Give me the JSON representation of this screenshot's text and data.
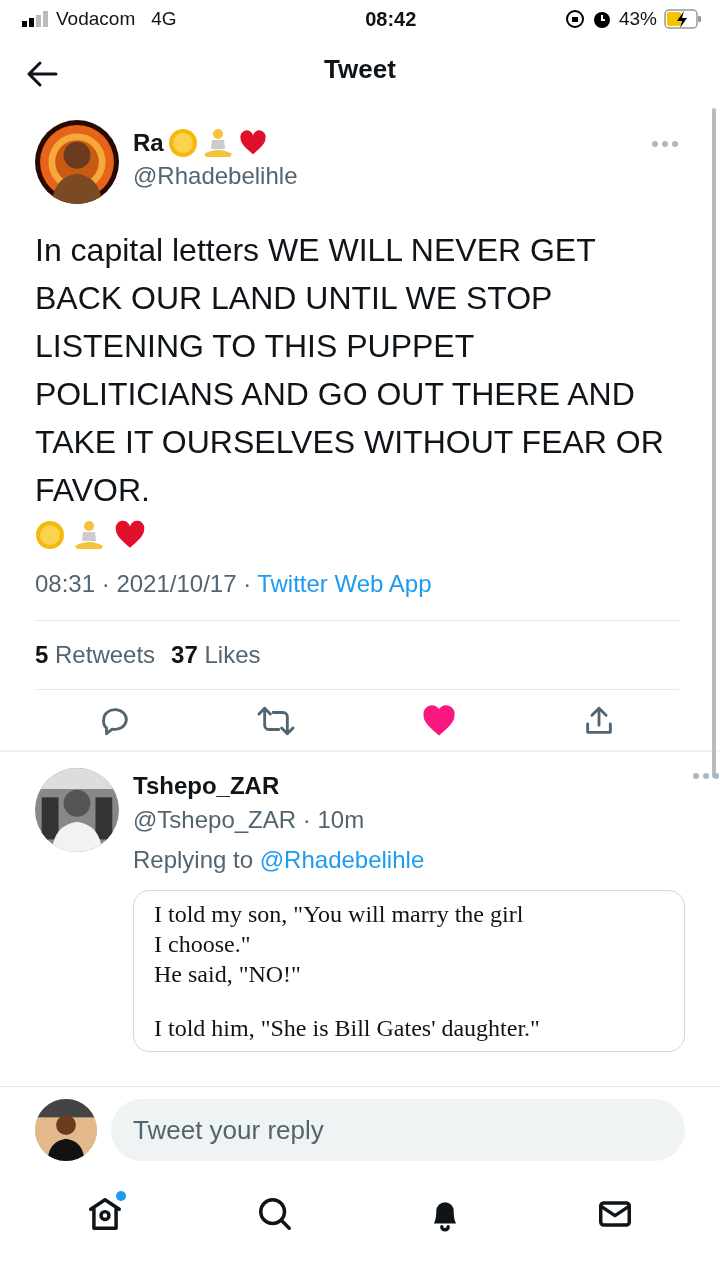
{
  "status_bar": {
    "carrier": "Vodacom",
    "network": "4G",
    "time": "08:42",
    "battery": "43%"
  },
  "header": {
    "title": "Tweet"
  },
  "tweet": {
    "name": "Ra",
    "handle": "@Rhadebelihle",
    "text": "In capital letters WE WILL NEVER GET BACK OUR LAND UNTIL WE STOP LISTENING TO THIS PUPPET POLITICIANS AND GO OUT THERE AND TAKE IT OURSELVES WITHOUT FEAR OR FAVOR.",
    "time": "08:31 · 2021/10/17 ·",
    "source": "Twitter Web App",
    "stats": [
      {
        "count": "5",
        "label": "Retweets"
      },
      {
        "count": "37",
        "label": "Likes"
      }
    ],
    "actions": [
      {
        "kind": "reply"
      },
      {
        "kind": "retweet"
      },
      {
        "kind": "like",
        "liked": true
      },
      {
        "kind": "share"
      }
    ]
  },
  "reply": {
    "name": "Tshepo_ZAR",
    "handle": "@Tshepo_ZAR",
    "age": "· 10m",
    "replying_label": "Replying to",
    "replying_to": "@Rhadebelihle",
    "image_paragraphs": [
      [
        "I told my son, \"You will marry the girl",
        "I choose.\"",
        "He said, \"NO!\""
      ],
      [
        "I told him, \"She is Bill Gates' daughter.\""
      ]
    ]
  },
  "composer": {
    "placeholder": "Tweet your reply"
  },
  "tab_bar": [
    {
      "kind": "home",
      "badge": true
    },
    {
      "kind": "search",
      "badge": false
    },
    {
      "kind": "notifications",
      "badge": false
    },
    {
      "kind": "messages",
      "badge": false
    }
  ]
}
